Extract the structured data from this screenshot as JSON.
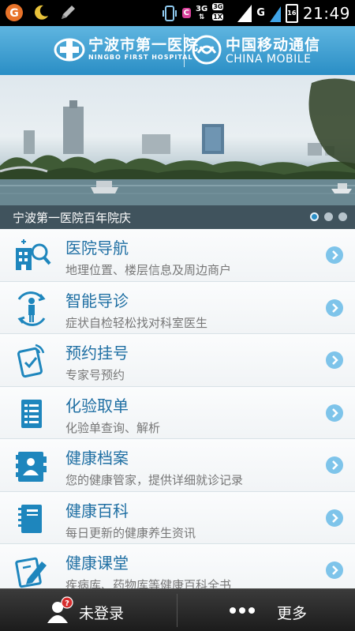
{
  "status_bar": {
    "time": "21:49",
    "network_3g": "3G",
    "network_3g_1x": "3G",
    "network_1x": "1X",
    "network_g": "G",
    "battery_level": "16",
    "app_badge": "C"
  },
  "header": {
    "hospital_name": "宁波市第一医院",
    "hospital_name_en": "NINGBO FIRST HOSPITAL",
    "carrier_name": "中国移动通信",
    "carrier_name_en": "CHINA MOBILE"
  },
  "banner": {
    "caption": "宁波第一医院百年院庆",
    "slide_count": 3,
    "active_slide": 1
  },
  "menu": {
    "items": [
      {
        "title": "医院导航",
        "desc": "地理位置、楼层信息及周边商户",
        "icon": "hospital-search-icon"
      },
      {
        "title": "智能导诊",
        "desc": "症状自检轻松找对科室医生",
        "icon": "body-scan-icon"
      },
      {
        "title": "预约挂号",
        "desc": "专家号预约",
        "icon": "appointment-phone-icon"
      },
      {
        "title": "化验取单",
        "desc": "化验单查询、解析",
        "icon": "lab-report-icon"
      },
      {
        "title": "健康档案",
        "desc": "您的健康管家，提供详细就诊记录",
        "icon": "contact-book-icon"
      },
      {
        "title": "健康百科",
        "desc": "每日更新的健康养生资讯",
        "icon": "notebook-icon"
      },
      {
        "title": "健康课堂",
        "desc": "疾病库、药物库等健康百科全书",
        "icon": "edit-document-icon"
      }
    ]
  },
  "bottom_bar": {
    "login_label": "未登录",
    "login_badge": "?",
    "more_label": "更多"
  },
  "colors": {
    "header_top": "#5fb5e0",
    "header_bottom": "#2a8ec5",
    "title_blue": "#1f6fa3",
    "icon_blue": "#1e86bd",
    "arrow_blue": "#7ec4ea"
  }
}
